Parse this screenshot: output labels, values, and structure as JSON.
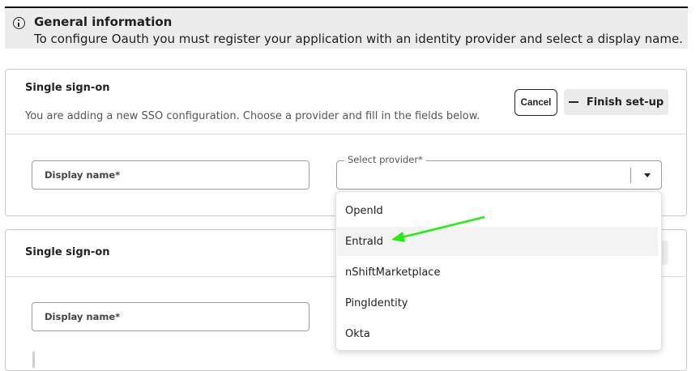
{
  "info": {
    "title": "General information",
    "text": "To configure Oauth you must register your application with an identity provider and select a display name."
  },
  "sso_card": {
    "title": "Single sign-on",
    "subtitle": "You are adding a new SSO configuration. Choose a provider and fill in the fields below.",
    "cancel_label": "Cancel",
    "finish_label": "Finish set-up",
    "display_name_placeholder": "Display name*",
    "provider_label": "Select provider*"
  },
  "sso_card_2": {
    "title": "Single sign-on",
    "display_name_placeholder": "Display name*"
  },
  "provider_options": [
    "OpenId",
    "EntraId",
    "nShiftMarketplace",
    "PingIdentity",
    "Okta"
  ],
  "highlighted_option": "EntraId",
  "colors": {
    "annotation_arrow": "#22ee11",
    "banner_bg": "#ececec",
    "finish_bg": "#ebebeb"
  },
  "icons": {
    "info": "info-circle-icon",
    "finish": "minus-icon",
    "select": "chevron-down-icon"
  }
}
